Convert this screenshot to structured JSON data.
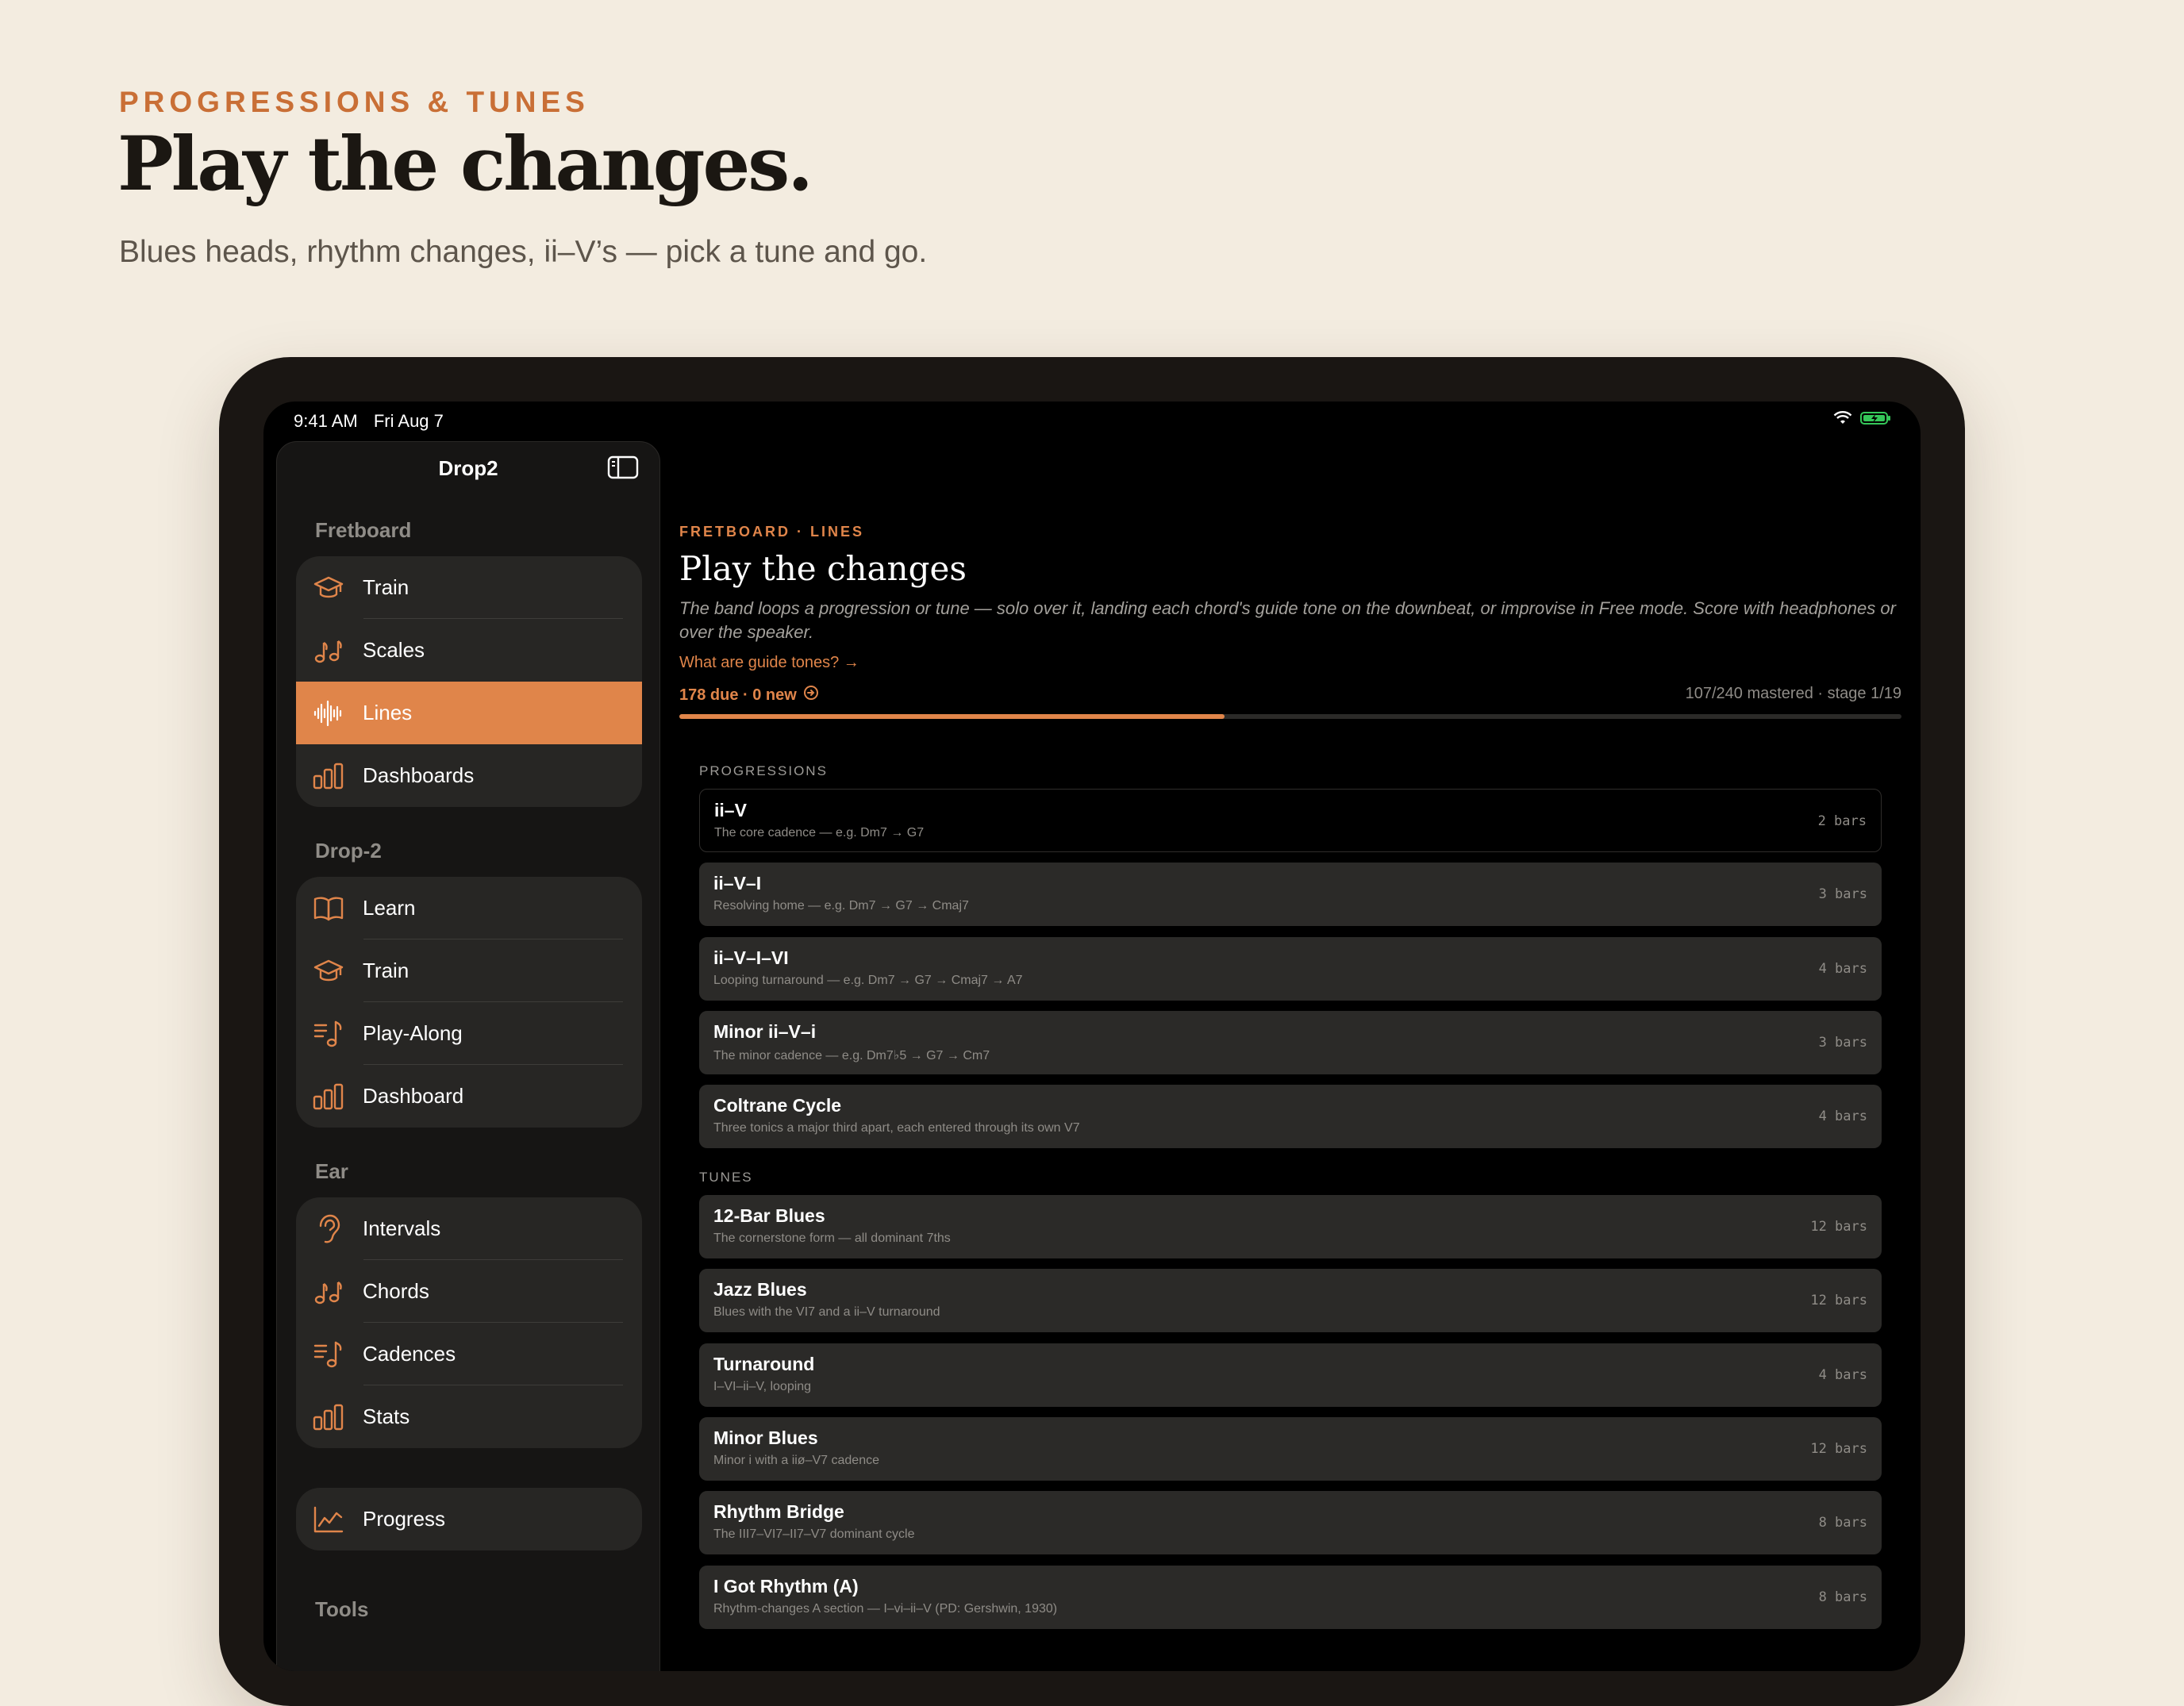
{
  "hero": {
    "eyebrow": "PROGRESSIONS & TUNES",
    "title": "Play the changes.",
    "subtitle": "Blues heads, rhythm changes, ii–V’s — pick a tune and go."
  },
  "status_bar": {
    "time": "9:41 AM",
    "date": "Fri Aug 7"
  },
  "colors": {
    "accent": "#e0854a",
    "battery": "#35c759",
    "page_bg": "#f3ece0"
  },
  "sidebar": {
    "title": "Drop2",
    "sections": [
      {
        "label": "Fretboard",
        "items": [
          {
            "label": "Train",
            "icon": "graduation-cap-icon"
          },
          {
            "label": "Scales",
            "icon": "music-notes-icon"
          },
          {
            "label": "Lines",
            "icon": "waveform-icon",
            "active": true
          },
          {
            "label": "Dashboards",
            "icon": "bar-chart-icon"
          }
        ]
      },
      {
        "label": "Drop-2",
        "items": [
          {
            "label": "Learn",
            "icon": "book-icon"
          },
          {
            "label": "Train",
            "icon": "graduation-cap-icon"
          },
          {
            "label": "Play-Along",
            "icon": "music-list-icon"
          },
          {
            "label": "Dashboard",
            "icon": "bar-chart-icon"
          }
        ]
      },
      {
        "label": "Ear",
        "items": [
          {
            "label": "Intervals",
            "icon": "ear-icon"
          },
          {
            "label": "Chords",
            "icon": "music-notes-icon"
          },
          {
            "label": "Cadences",
            "icon": "music-list-icon"
          },
          {
            "label": "Stats",
            "icon": "bar-chart-icon"
          }
        ]
      }
    ],
    "progress": {
      "label": "Progress",
      "icon": "line-chart-icon"
    },
    "tools_label": "Tools"
  },
  "main": {
    "eyebrow": "FRETBOARD · LINES",
    "title": "Play the changes",
    "description": "The band loops a progression or tune — solo over it, landing each chord's guide tone on the downbeat, or improvise in Free mode. Score with headphones or over the speaker.",
    "guide_link": "What are guide tones? →",
    "due": "178 due · 0 new",
    "mastered": "107/240 mastered · stage 1/19",
    "progress_fraction": 0.446,
    "progressions_label": "PROGRESSIONS",
    "tunes_label": "TUNES",
    "progressions": [
      {
        "title": "ii–V",
        "subtitle": "The core cadence — e.g. Dm7 → G7",
        "bars": "2 bars",
        "selected": true
      },
      {
        "title": "ii–V–I",
        "subtitle": "Resolving home — e.g. Dm7 → G7 → Cmaj7",
        "bars": "3 bars"
      },
      {
        "title": "ii–V–I–VI",
        "subtitle": "Looping turnaround — e.g. Dm7 → G7 → Cmaj7 → A7",
        "bars": "4 bars"
      },
      {
        "title": "Minor ii–V–i",
        "subtitle": "The minor cadence — e.g. Dm7♭5 → G7 → Cm7",
        "bars": "3 bars"
      },
      {
        "title": "Coltrane Cycle",
        "subtitle": "Three tonics a major third apart, each entered through its own V7",
        "bars": "4 bars"
      }
    ],
    "tunes": [
      {
        "title": "12-Bar Blues",
        "subtitle": "The cornerstone form — all dominant 7ths",
        "bars": "12 bars"
      },
      {
        "title": "Jazz Blues",
        "subtitle": "Blues with the VI7 and a ii–V turnaround",
        "bars": "12 bars"
      },
      {
        "title": "Turnaround",
        "subtitle": "I–VI–ii–V, looping",
        "bars": "4 bars"
      },
      {
        "title": "Minor Blues",
        "subtitle": "Minor i with a iiø–V7 cadence",
        "bars": "12 bars"
      },
      {
        "title": "Rhythm Bridge",
        "subtitle": "The III7–VI7–II7–V7 dominant cycle",
        "bars": "8 bars"
      },
      {
        "title": "I Got Rhythm (A)",
        "subtitle": "Rhythm-changes A section — I–vi–ii–V (PD: Gershwin, 1930)",
        "bars": "8 bars"
      }
    ]
  }
}
